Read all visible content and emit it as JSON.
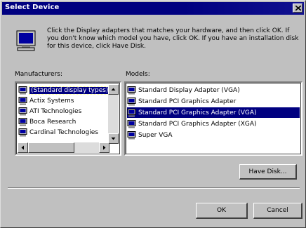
{
  "window": {
    "title": "Select Device"
  },
  "instructions": "Click the Display adapters that matches your hardware, and then click OK. If you don't know which model you have, click OK. If you have an installation disk for this device, click Have Disk.",
  "manufacturers": {
    "label": "Manufacturers:",
    "items": [
      {
        "label": "(Standard display types)",
        "selected": true
      },
      {
        "label": "Actix Systems"
      },
      {
        "label": "ATI Technologies"
      },
      {
        "label": "Boca Research"
      },
      {
        "label": "Cardinal Technologies"
      }
    ]
  },
  "models": {
    "label": "Models:",
    "items": [
      {
        "label": "Standard Display Adapter (VGA)"
      },
      {
        "label": "Standard PCI Graphics Adapter"
      },
      {
        "label": "Standard PCI Graphics Adapter (VGA)",
        "selected": true
      },
      {
        "label": "Standard PCI Graphics Adapter (XGA)"
      },
      {
        "label": "Super VGA"
      }
    ]
  },
  "buttons": {
    "have_disk": "Have Disk...",
    "ok": "OK",
    "cancel": "Cancel"
  },
  "colors": {
    "title_bar": "#000080",
    "face": "#c0c0c0",
    "selection": "#000080"
  }
}
